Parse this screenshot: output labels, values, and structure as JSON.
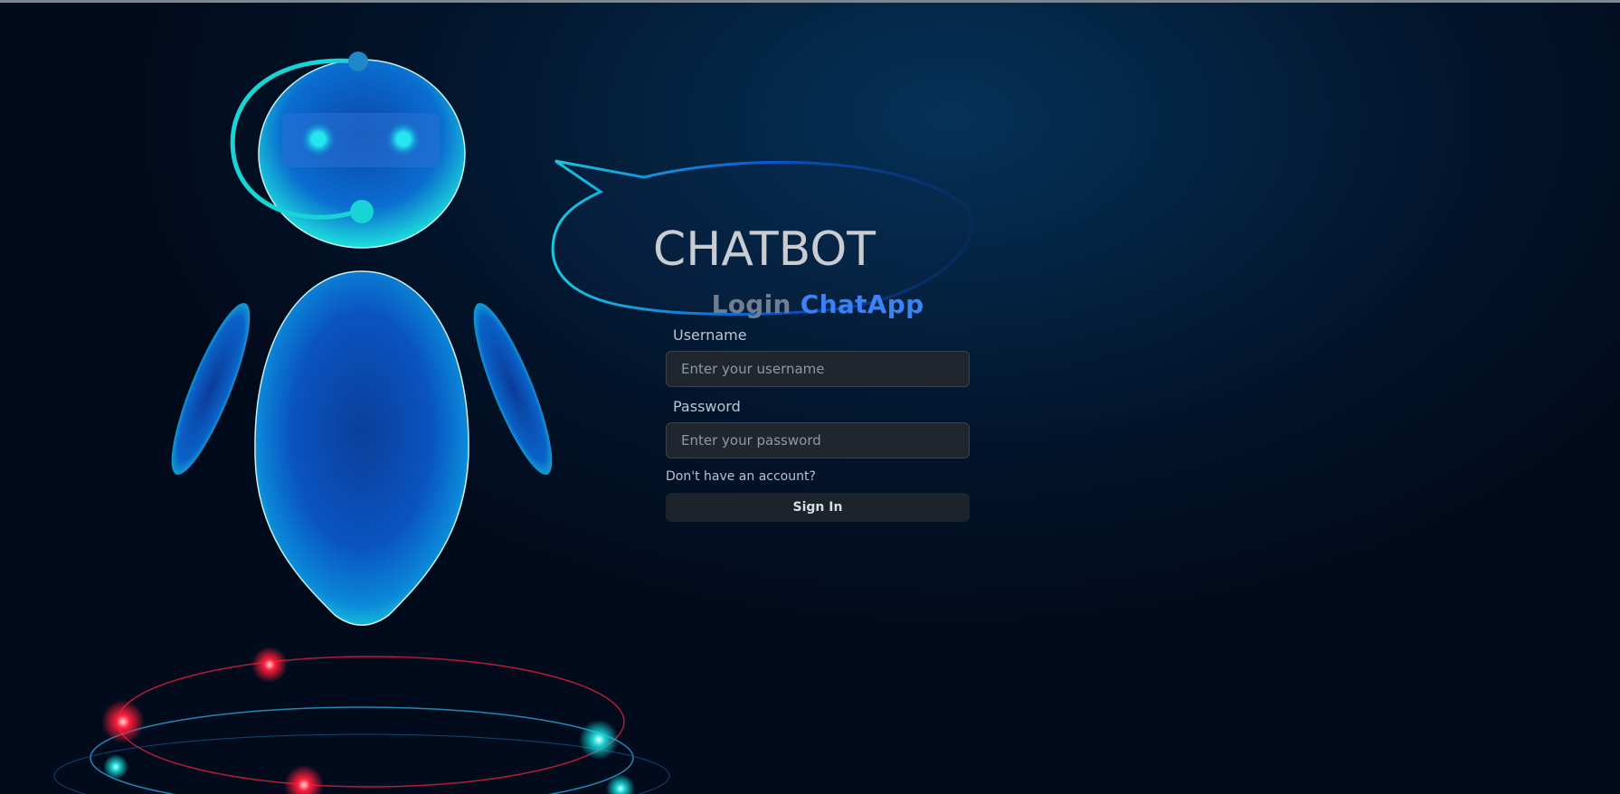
{
  "hero": {
    "bubble_text": "CHATBOT"
  },
  "login": {
    "title_prefix": "Login",
    "title_brand": "ChatApp",
    "username_label": "Username",
    "username_placeholder": "Enter your username",
    "username_value": "",
    "password_label": "Password",
    "password_placeholder": "Enter your password",
    "password_value": "",
    "signup_link": "Don't have an account?",
    "signin_button": "Sign In"
  },
  "colors": {
    "background": "#020b1c",
    "robot_glow": "#19d4d4",
    "brand_accent": "#3b82f6",
    "input_background": "#20262e",
    "orbit_red": "#ff1e3c"
  }
}
